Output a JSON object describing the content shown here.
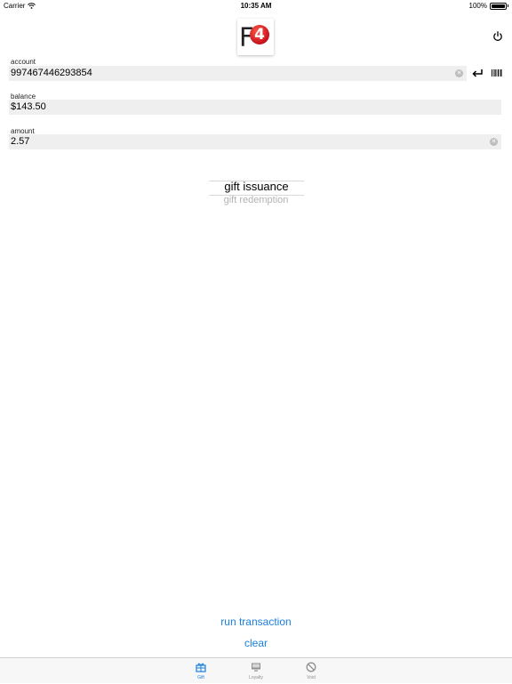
{
  "status": {
    "carrier": "Carrier",
    "time": "10:35 AM",
    "battery": "100%"
  },
  "logo": {
    "letter": "F",
    "badge": "4"
  },
  "fields": {
    "account": {
      "label": "account",
      "value": "997467446293854"
    },
    "balance": {
      "label": "balance",
      "value": "$143.50"
    },
    "amount": {
      "label": "amount",
      "value": "2.57"
    }
  },
  "picker": {
    "selected": "gift issuance",
    "next": "gift redemption"
  },
  "actions": {
    "run": "run transaction",
    "clear": "clear"
  },
  "tabs": [
    {
      "label": "Gift",
      "icon": "gift-icon",
      "active": true
    },
    {
      "label": "Loyalty",
      "icon": "monitor-icon",
      "active": false
    },
    {
      "label": "Void",
      "icon": "prohibited-icon",
      "active": false
    }
  ],
  "colors": {
    "accent": "#1a7fe0",
    "tab_inactive": "#8e8e93",
    "field_bg": "#efefef",
    "logo_badge": "#d2111c"
  }
}
